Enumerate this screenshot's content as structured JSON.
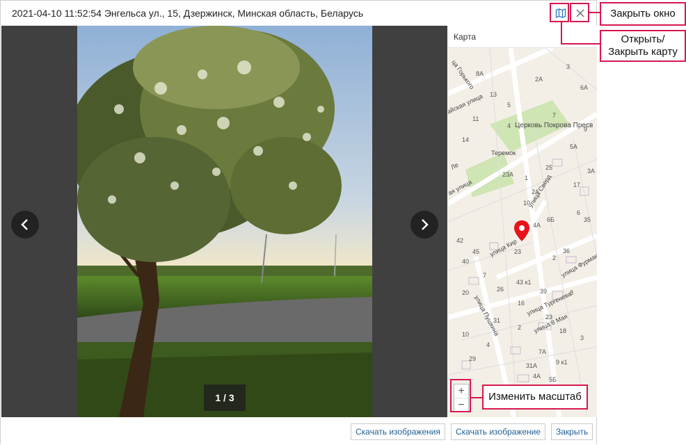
{
  "window": {
    "title": "2021-04-10 11:52:54 Энгельса ул., 15, Дзержинск, Минская область, Беларусь"
  },
  "header_icons": {
    "map_toggle": "map-icon",
    "close": "close-icon"
  },
  "viewer": {
    "counter": "1 / 3",
    "prev_icon": "chevron-left-icon",
    "next_icon": "chevron-right-icon"
  },
  "map": {
    "header": "Карта",
    "zoom_in": "+",
    "zoom_out": "−",
    "marker_icon": "map-pin-icon",
    "streets": {
      "church": "Церковь Покрова Пресв",
      "teremok": "Теремок",
      "ul1": "ая улица",
      "ul2": "улица Сверд",
      "ul3": "улица Кир",
      "ul4": "улица Пушкина",
      "ul5": "улица Тургенева",
      "ul6": "улица Фурманова",
      "ul7": "улица 8 Мая",
      "ul8": "айская улица",
      "ul9": "ца Горького",
      "ul10": "Ле"
    },
    "houses": [
      "8А",
      "2А",
      "3",
      "5",
      "7",
      "6А",
      "13",
      "14",
      "23А",
      "17",
      "10",
      "4А",
      "6Б",
      "42",
      "40",
      "45",
      "23",
      "36",
      "43 к1",
      "39",
      "16",
      "10",
      "29",
      "7А",
      "31А",
      "4А",
      "5Б",
      "9 к1",
      "3",
      "3А",
      "35",
      "2",
      "6",
      "25",
      "1",
      "2А",
      "5А",
      "9",
      "11",
      "4",
      "7",
      "20",
      "23",
      "18",
      "26",
      "31",
      "8",
      "4",
      "2"
    ]
  },
  "footer": {
    "download_images": "Скачать изображения",
    "download_image": "Скачать изображение",
    "close": "Закрыть"
  },
  "annotations": {
    "close_window": "Закрыть окно",
    "toggle_map": "Открыть/ Закрыть карту",
    "zoom": "Изменить масштаб"
  },
  "colors": {
    "accent": "#d8164f",
    "link": "#1f5f94",
    "marker": "#e8121a"
  }
}
